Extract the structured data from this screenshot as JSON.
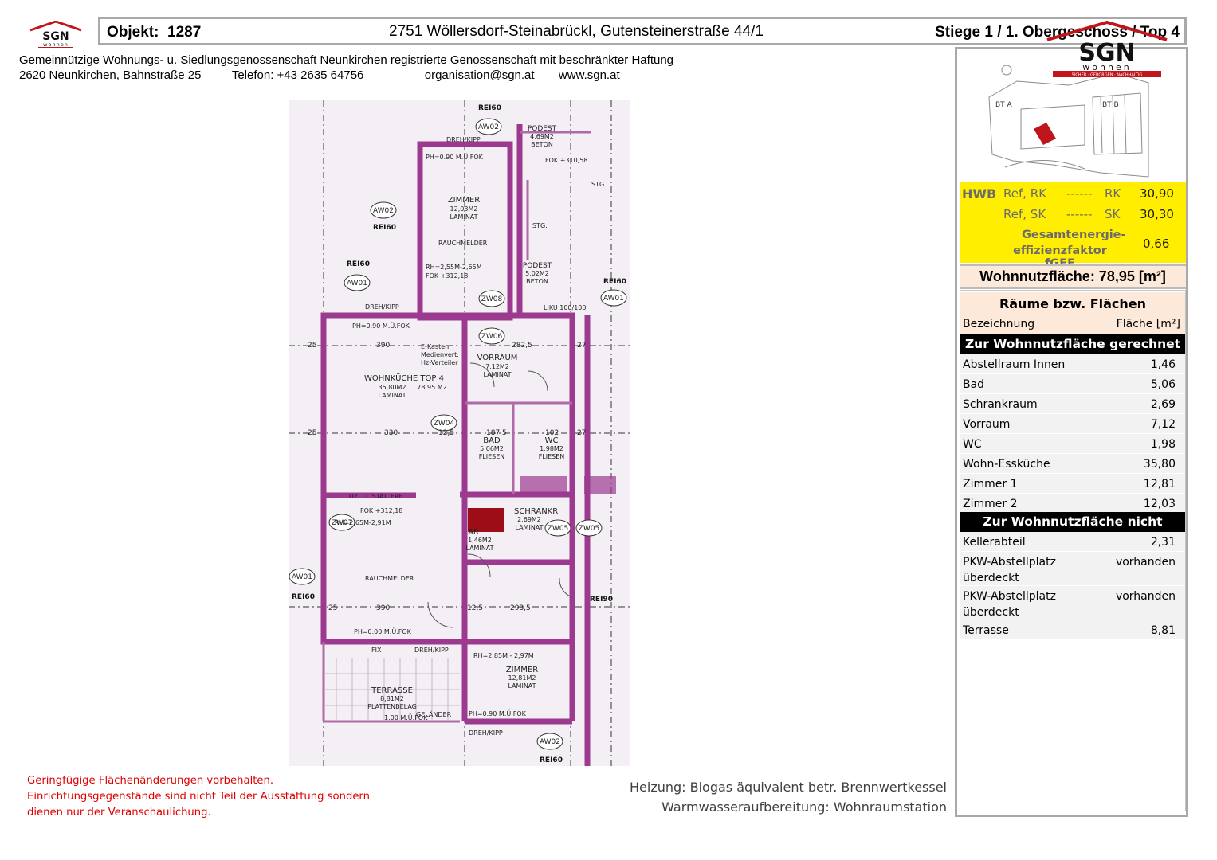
{
  "header": {
    "logo_text": "SGN",
    "logo_sub": "wohnen",
    "objekt_label": "Objekt:",
    "objekt_value": "1287",
    "address": "2751 Wöllersdorf-Steinabrückl, Gutensteinerstraße 44/1",
    "stiege": "Stiege 1 / 1. Obergeschoss / Top 4"
  },
  "company": {
    "name": "Gemeinnützige Wohnungs- u. Siedlungsgenossenschaft Neunkirchen registrierte Genossenschaft mit beschränkter Haftung",
    "address": "2620 Neunkirchen, Bahnstraße 25",
    "phone": "Telefon: +43 2635 64756",
    "email": "organisation@sgn.at",
    "web": "www.sgn.at"
  },
  "site_plan": {
    "logo_text": "SGN",
    "logo_sub": "wohnen",
    "logo_tagline": "SICHER · GEBORGEN · NACHHALTIG",
    "labels": [
      "BT A",
      "BT B"
    ]
  },
  "energy": {
    "hwb_label": "HWB",
    "rows": [
      {
        "ref": "Ref, RK",
        "dash": "------",
        "key": "RK",
        "value": "30,90"
      },
      {
        "ref": "Ref, SK",
        "dash": "------",
        "key": "SK",
        "value": "30,30"
      }
    ],
    "fgee_label_1": "Gesamtenergie-",
    "fgee_label_2": "effizienzfaktor fGEE",
    "fgee_value": "0,66"
  },
  "wohnnutzflaeche": "Wohnnutzfläche: 78,95 [m²]",
  "rooms": {
    "title": "Räume bzw. Flächen",
    "col_name": "Bezeichnung",
    "col_area": "Fläche [m²]",
    "section_included": "Zur Wohnnutzfläche gerechnet",
    "included": [
      {
        "name": "Abstellraum Innen",
        "area": "1,46"
      },
      {
        "name": "Bad",
        "area": "5,06"
      },
      {
        "name": "Schrankraum",
        "area": "2,69"
      },
      {
        "name": "Vorraum",
        "area": "7,12"
      },
      {
        "name": "WC",
        "area": "1,98"
      },
      {
        "name": "Wohn-Essküche",
        "area": "35,80"
      },
      {
        "name": "Zimmer 1",
        "area": "12,81"
      },
      {
        "name": "Zimmer 2",
        "area": "12,03"
      }
    ],
    "section_excluded": "Zur Wohnnutzfläche nicht gerechnet",
    "excluded": [
      {
        "name": "Kellerabteil",
        "area": "2,31"
      },
      {
        "name": "PKW-Abstellplatz",
        "name2": "überdeckt",
        "area": "vorhanden"
      },
      {
        "name": "PKW-Abstellplatz",
        "name2": "überdeckt",
        "area": "vorhanden"
      },
      {
        "name": "Terrasse",
        "area": "8,81"
      }
    ]
  },
  "floorplan": {
    "rooms": [
      {
        "name": "ZIMMER",
        "area": "12,03M2",
        "floor": "LAMINAT"
      },
      {
        "name": "WOHNKÜCHE TOP 4",
        "area": "35,80M2",
        "total": "78,95 M2",
        "floor": "LAMINAT"
      },
      {
        "name": "VORRAUM",
        "area": "7,12M2",
        "floor": "LAMINAT"
      },
      {
        "name": "BAD",
        "area": "5,06M2",
        "floor": "FLIESEN"
      },
      {
        "name": "WC",
        "area": "1,98M2",
        "floor": "FLIESEN"
      },
      {
        "name": "SCHRANKR.",
        "area": "2,69M2",
        "floor": "LAMINAT"
      },
      {
        "name": "AR",
        "area": "1,46M2",
        "floor": "LAMINAT"
      },
      {
        "name": "ZIMMER",
        "area": "12,81M2",
        "floor": "LAMINAT"
      },
      {
        "name": "TERRASSE",
        "area": "8,81M2",
        "floor": "PLATTENBELAG"
      },
      {
        "name": "PODEST",
        "area": "4,69M2",
        "floor": "BETON"
      },
      {
        "name": "PODEST",
        "area": "5,02M2",
        "floor": "BETON"
      }
    ],
    "labels": {
      "rei60": "REI60",
      "rei90": "REI90",
      "aw01": "AW01",
      "aw02": "AW02",
      "zw04": "ZW04",
      "zw05": "ZW05",
      "zw06": "ZW06",
      "zw07": "ZW07",
      "zw08": "ZW08",
      "ph090": "PH=0.90 M.Ü.FOK",
      "ph000": "PH=0.00 M.Ü.FOK",
      "rh1": "RH=2,55M-2,65M",
      "fok1": "FOK +312,18",
      "fok2": "FOK +312,18",
      "rh2": "RH=2,65M-2,91M",
      "rh3": "RH=2,85M - 2,97M",
      "fok3": "FOK +310,58",
      "rauchmelder": "RAUCHMELDER",
      "dreh": "DREH/KIPP",
      "ekasten": "E-Kasten",
      "medienvert": "Medienvert.",
      "hzvert": "Hz-Verteiler",
      "uz": "UZ. LT. STAT. ERF.",
      "gelaender": "GELÄNDER",
      "gel2": "1.00 M.Ü.FOK",
      "fix": "FIX",
      "liku": "LIKU 100/100",
      "stg": "STG.",
      "dim390": "390",
      "dim330": "330",
      "dim282": "282,5",
      "dim187": "187,5",
      "dim102": "102",
      "dim293": "293,5",
      "dim25": "25",
      "dim27": "27",
      "dim12": "12,5"
    }
  },
  "notes": {
    "red_1": "Geringfügige Flächenänderungen vorbehalten.",
    "red_2": "Einrichtungsgegenstände sind nicht Teil der Ausstattung sondern",
    "red_3": "dienen nur der Veranschaulichung.",
    "heating": "Heizung: Biogas äquivalent  betr. Brennwertkessel",
    "water": "Warmwasseraufbereitung: Wohnraumstation"
  }
}
